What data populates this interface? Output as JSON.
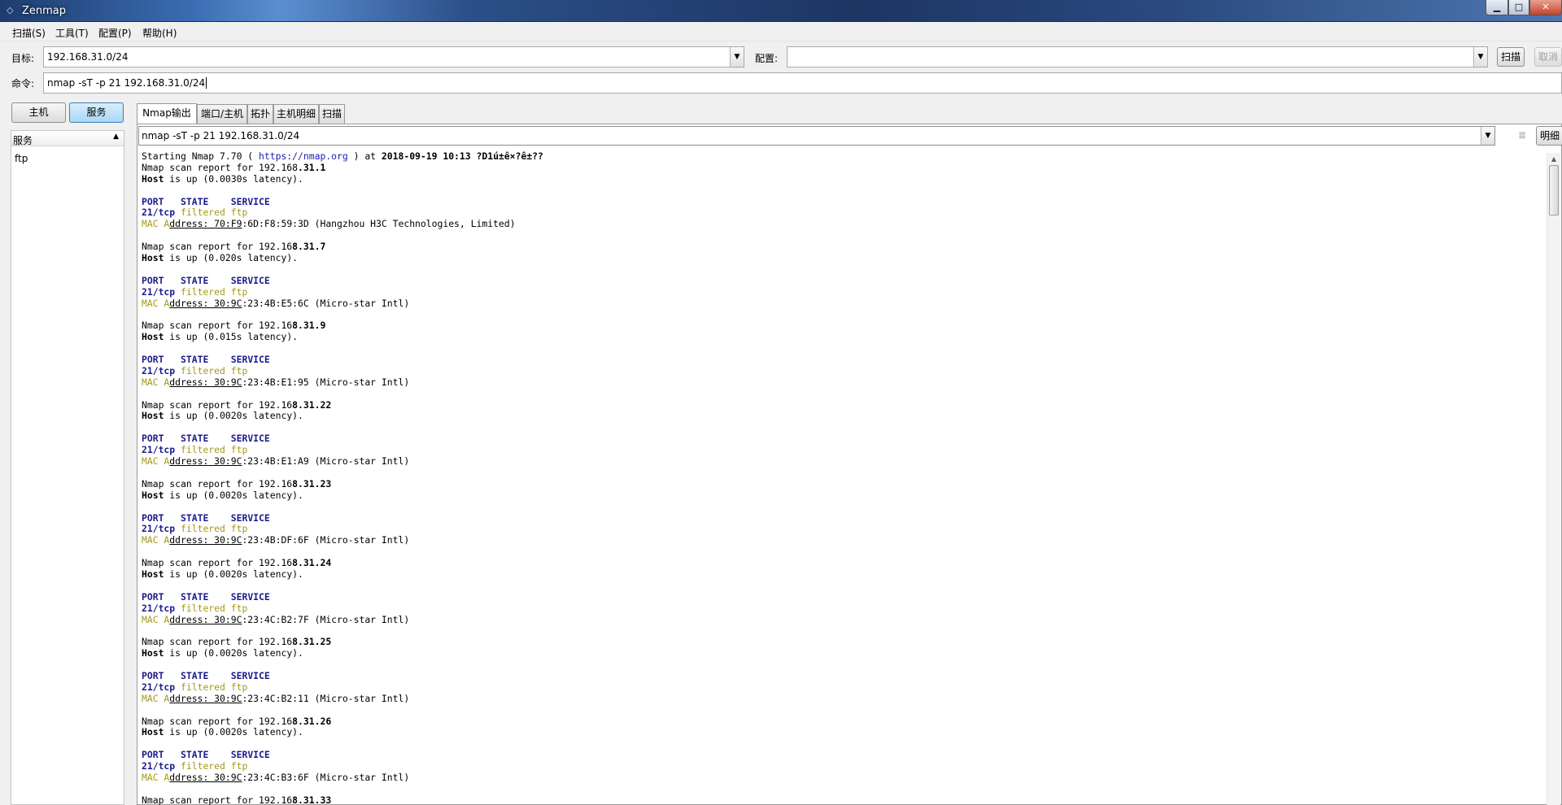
{
  "window": {
    "title": "Zenmap",
    "icon": "zenmap-eye-icon"
  },
  "menu": [
    "扫描(S)",
    "工具(T)",
    "配置(P)",
    "帮助(H)"
  ],
  "toolbar": {
    "target_label": "目标:",
    "target_value": "192.168.31.0/24",
    "profile_label": "配置:",
    "profile_value": "",
    "scan_button": "扫描",
    "cancel_button": "取消",
    "command_label": "命令:",
    "command_value": "nmap -sT -p 21 192.168.31.0/24"
  },
  "left_panel": {
    "hosts_button": "主机",
    "services_button": "服务",
    "column_header": "服务",
    "services": [
      "ftp"
    ]
  },
  "tabs": [
    "Nmap输出",
    "端口/主机",
    "拓扑",
    "主机明细",
    "扫描"
  ],
  "active_tab": 0,
  "output_panel": {
    "command_combo": "nmap -sT -p 21 192.168.31.0/24",
    "details_button": "明细",
    "header": {
      "start_prefix": "Starting Nmap 7.70 ( ",
      "url": "https://nmap.org",
      "start_mid": " ) at ",
      "datetime": "2018-09-19 10:13",
      "tail": " ?D1ú±ê×?ê±??"
    },
    "port_header": [
      "PORT",
      "STATE",
      "SERVICE"
    ],
    "hosts": [
      {
        "ip_prefix": "192.168",
        "ip_suffix": ".31.1",
        "latency": "(0.0030s latency).",
        "port": "21/tcp",
        "state": "filtered",
        "service": "ftp",
        "mac_bold": "70:F9",
        "mac_rest": ":6D:F8:59:3D",
        "vendor": "(Hangzhou H3C Technologies, Limited)"
      },
      {
        "ip_prefix": "192.16",
        "ip_suffix": "8.31.7",
        "latency": "(0.020s latency).",
        "port": "21/tcp",
        "state": "filtered",
        "service": "ftp",
        "mac_bold": "30:9C",
        "mac_rest": ":23:4B:E5:6C",
        "vendor": "(Micro-star Intl)"
      },
      {
        "ip_prefix": "192.16",
        "ip_suffix": "8.31.9",
        "latency": "(0.015s latency).",
        "port": "21/tcp",
        "state": "filtered",
        "service": "ftp",
        "mac_bold": "30:9C",
        "mac_rest": ":23:4B:E1:95",
        "vendor": "(Micro-star Intl)"
      },
      {
        "ip_prefix": "192.16",
        "ip_suffix": "8.31.22",
        "latency": "(0.0020s latency).",
        "port": "21/tcp",
        "state": "filtered",
        "service": "ftp",
        "mac_bold": "30:9C",
        "mac_rest": ":23:4B:E1:A9",
        "vendor": "(Micro-star Intl)"
      },
      {
        "ip_prefix": "192.16",
        "ip_suffix": "8.31.23",
        "latency": "(0.0020s latency).",
        "port": "21/tcp",
        "state": "filtered",
        "service": "ftp",
        "mac_bold": "30:9C",
        "mac_rest": ":23:4B:DF:6F",
        "vendor": "(Micro-star Intl)"
      },
      {
        "ip_prefix": "192.16",
        "ip_suffix": "8.31.24",
        "latency": "(0.0020s latency).",
        "port": "21/tcp",
        "state": "filtered",
        "service": "ftp",
        "mac_bold": "30:9C",
        "mac_rest": ":23:4C:B2:7F",
        "vendor": "(Micro-star Intl)"
      },
      {
        "ip_prefix": "192.16",
        "ip_suffix": "8.31.25",
        "latency": "(0.0020s latency).",
        "port": "21/tcp",
        "state": "filtered",
        "service": "ftp",
        "mac_bold": "30:9C",
        "mac_rest": ":23:4C:B2:11",
        "vendor": "(Micro-star Intl)"
      },
      {
        "ip_prefix": "192.16",
        "ip_suffix": "8.31.26",
        "latency": "(0.0020s latency).",
        "port": "21/tcp",
        "state": "filtered",
        "service": "ftp",
        "mac_bold": "30:9C",
        "mac_rest": ":23:4C:B3:6F",
        "vendor": "(Micro-star Intl)"
      },
      {
        "ip_prefix": "192.16",
        "ip_suffix": "8.31.33",
        "latency": "",
        "port": "",
        "state": "",
        "service": "",
        "mac_bold": "",
        "mac_rest": "",
        "vendor": ""
      }
    ],
    "strings": {
      "report_prefix": "Nmap scan report for ",
      "host_word": "Host",
      "is_up": " is up ",
      "mac_prefix": "MAC A",
      "mac_mid": "ddress: "
    }
  },
  "colors": {
    "port_blue": "#1b1b8c",
    "filtered_yellow": "#a6981a",
    "url_blue": "#1b1bb5",
    "active_toggle": "#a9d7f5"
  }
}
